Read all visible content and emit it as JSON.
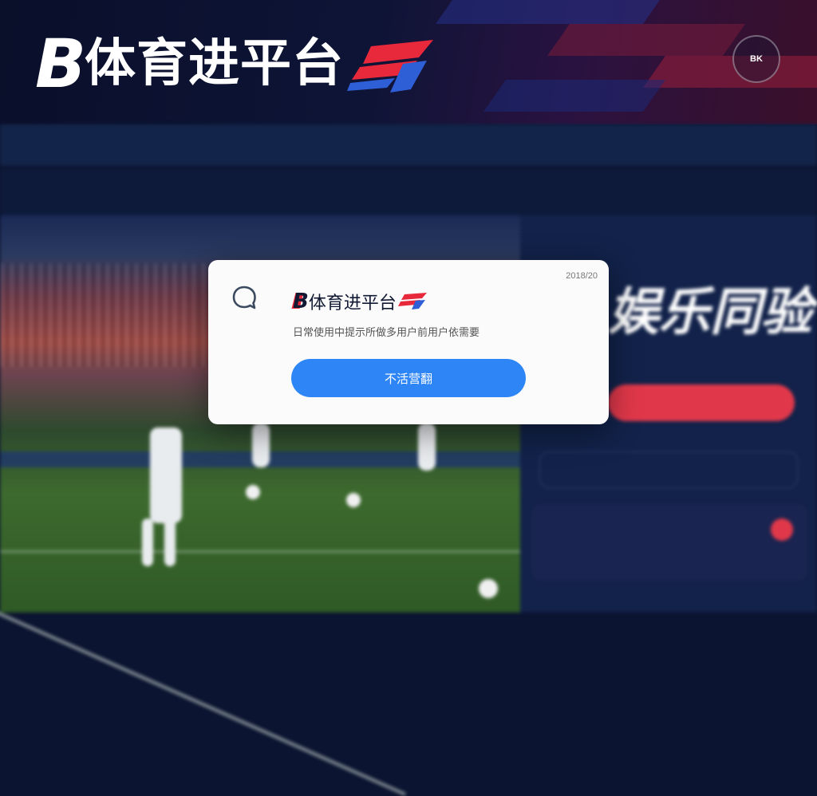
{
  "banner": {
    "logo_letter": "B",
    "logo_text": "体育进平台",
    "shield_text": "BK",
    "colors": {
      "accent_red": "#e8283b",
      "accent_blue": "#2e5fd6"
    }
  },
  "modal": {
    "timestamp": "2018/20",
    "brand_letter": "B",
    "brand_text": "体育进平台",
    "description": "日常使用中提示所做多用户前用户依需要",
    "button_label": "不活营翻",
    "icon": "chat-bubble-icon",
    "button_color": "#2e86f6"
  },
  "background": {
    "side_headline": "娱乐同验"
  }
}
